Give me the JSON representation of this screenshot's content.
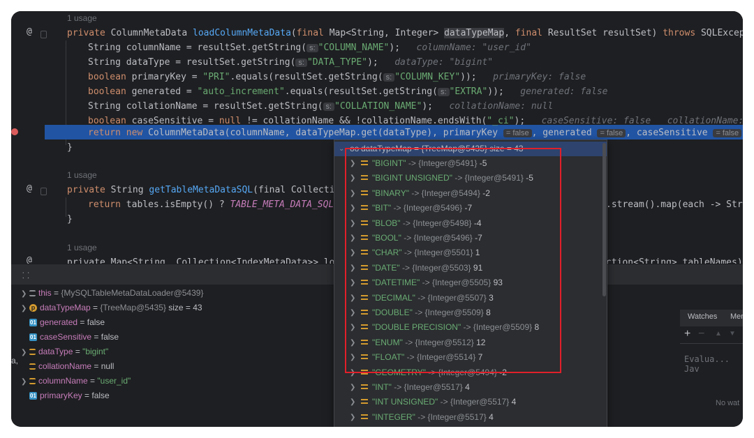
{
  "editor": {
    "lines": [
      {
        "type": "usage",
        "text": "1 usage"
      },
      {
        "type": "sig1"
      },
      {
        "type": "l",
        "code": "String columnName = resultSet.getString(",
        "param": "s:",
        "str": "\"COLUMN_NAME\"",
        "end": ");",
        "hint": "columnName: \"user_id\""
      },
      {
        "type": "l",
        "code": "String dataType = resultSet.getString(",
        "param": "s:",
        "str": "\"DATA_TYPE\"",
        "end": ");",
        "hint": "dataType: \"bigint\""
      },
      {
        "type": "boolpk"
      },
      {
        "type": "boolgen"
      },
      {
        "type": "l",
        "code": "String collationName = resultSet.getString(",
        "param": "s:",
        "str": "\"COLLATION_NAME\"",
        "end": ");",
        "hint": "collationName: null"
      },
      {
        "type": "boolcs"
      },
      {
        "type": "ret"
      },
      {
        "type": "close"
      },
      {
        "type": "blank"
      },
      {
        "type": "usage",
        "text": "1 usage"
      },
      {
        "type": "sig2"
      },
      {
        "type": "ret2"
      },
      {
        "type": "close"
      },
      {
        "type": "blank"
      },
      {
        "type": "usage",
        "text": "1 usage"
      },
      {
        "type": "sig3"
      }
    ],
    "sig1": {
      "private": "private",
      "class": "ColumnMetaData",
      "method": "loadColumnMetaData",
      "open": "(",
      "final1": "final",
      "t1": "Map<String, Integer>",
      "p1": "dataTypeMap",
      "final2": "final",
      "t2": "ResultSet resultSet)",
      "throws": "throws",
      "ex": "SQLException {"
    },
    "pk": {
      "bool": "boolean",
      "a": "primaryKey = ",
      "s1": "\"PRI\"",
      "b": ".equals(resultSet.getString(",
      "param": "s:",
      "s2": "\"COLUMN_KEY\"",
      "end": "));",
      "hint": "primaryKey: false"
    },
    "gen": {
      "bool": "boolean",
      "a": "generated = ",
      "s1": "\"auto_increment\"",
      "b": ".equals(resultSet.getString(",
      "param": "s:",
      "s2": "\"EXTRA\"",
      "end": "));",
      "hint": "generated: false"
    },
    "cs": {
      "bool": "boolean",
      "a": "caseSensitive = ",
      "nl": "null",
      "b": " != collationName && !collationName.endsWith(",
      "s1": "\"_ci\"",
      "end": ");",
      "hint1": "caseSensitive: false",
      "hint2": "collationName: null"
    },
    "ret": {
      "return": "return",
      "new": "new",
      "a": "ColumnMetaData(columnName, dataTypeMap.get(dataType), primaryKey",
      "h1": "= false",
      "b": ", generated",
      "h2": "= false",
      "c": ", caseSensitive",
      "h3": "= false",
      "end": ");"
    },
    "close": "}",
    "sig2": {
      "private": "private",
      "a": "String",
      "method": "getTableMetaDataSQL",
      "b": "(final Collection<"
    },
    "ret2": {
      "return": "return",
      "a": "tables.isEmpty() ? ",
      "it": "TABLE_META_DATA_SQL",
      "b": " :",
      "c": ".stream().map(each -> Strin"
    },
    "sig3": {
      "a": "private Map<String, Collection<IndexMetaData>> load",
      "b": "ction<String> tableNames) {"
    }
  },
  "debug": {
    "variables": [
      {
        "icon": "this",
        "expand": true,
        "name": "this",
        "eq": " = ",
        "obj": "{MySQLTableMetaDataLoader@5439}",
        "val": ""
      },
      {
        "icon": "p",
        "expand": true,
        "name": "dataTypeMap",
        "eq": " = ",
        "obj": "{TreeMap@5435}",
        "val": "  size = 43"
      },
      {
        "icon": "o",
        "expand": false,
        "name": "generated",
        "eq": " = ",
        "obj": "",
        "val": "false"
      },
      {
        "icon": "o",
        "expand": false,
        "name": "caseSensitive",
        "eq": " = ",
        "obj": "",
        "val": "false"
      },
      {
        "icon": "eq",
        "expand": true,
        "name": "dataType",
        "eq": " = ",
        "str": "\"bigint\"",
        "val": ""
      },
      {
        "icon": "eq",
        "expand": false,
        "name": "collationName",
        "eq": " = ",
        "obj": "",
        "val": "null"
      },
      {
        "icon": "eq",
        "expand": true,
        "name": "columnName",
        "eq": " = ",
        "str": "\"user_id\"",
        "val": ""
      },
      {
        "icon": "o",
        "expand": false,
        "name": "primaryKey",
        "eq": " = ",
        "obj": "",
        "val": "false"
      }
    ],
    "right": {
      "watches": "Watches",
      "mem": "Mem",
      "eval": "Evalua... Jav",
      "nowatch": "No wat"
    },
    "side_letter": "a,"
  },
  "popup": {
    "header": {
      "icon": "oo",
      "name": "dataTypeMap",
      "eq": " = ",
      "obj": "{TreeMap@5435}",
      "size": "  size = 43"
    },
    "entries": [
      {
        "key": "\"BIGINT\"",
        "obj": "{Integer@5491}",
        "val": "-5"
      },
      {
        "key": "\"BIGINT UNSIGNED\"",
        "obj": "{Integer@5491}",
        "val": "-5"
      },
      {
        "key": "\"BINARY\"",
        "obj": "{Integer@5494}",
        "val": "-2"
      },
      {
        "key": "\"BIT\"",
        "obj": "{Integer@5496}",
        "val": "-7"
      },
      {
        "key": "\"BLOB\"",
        "obj": "{Integer@5498}",
        "val": "-4"
      },
      {
        "key": "\"BOOL\"",
        "obj": "{Integer@5496}",
        "val": "-7"
      },
      {
        "key": "\"CHAR\"",
        "obj": "{Integer@5501}",
        "val": "1"
      },
      {
        "key": "\"DATE\"",
        "obj": "{Integer@5503}",
        "val": "91"
      },
      {
        "key": "\"DATETIME\"",
        "obj": "{Integer@5505}",
        "val": "93"
      },
      {
        "key": "\"DECIMAL\"",
        "obj": "{Integer@5507}",
        "val": "3"
      },
      {
        "key": "\"DOUBLE\"",
        "obj": "{Integer@5509}",
        "val": "8"
      },
      {
        "key": "\"DOUBLE PRECISION\"",
        "obj": "{Integer@5509}",
        "val": "8"
      },
      {
        "key": "\"ENUM\"",
        "obj": "{Integer@5512}",
        "val": "12"
      },
      {
        "key": "\"FLOAT\"",
        "obj": "{Integer@5514}",
        "val": "7"
      },
      {
        "key": "\"GEOMETRY\"",
        "obj": "{Integer@5494}",
        "val": "-2"
      },
      {
        "key": "\"INT\"",
        "obj": "{Integer@5517}",
        "val": "4"
      },
      {
        "key": "\"INT UNSIGNED\"",
        "obj": "{Integer@5517}",
        "val": "4"
      },
      {
        "key": "\"INTEGER\"",
        "obj": "{Integer@5517}",
        "val": "4"
      }
    ],
    "arrow": " -> "
  },
  "colors": {
    "highlight": "#2154a3",
    "annotation": "#e0202a",
    "string": "#6aab73",
    "keyword": "#cf8e6d"
  }
}
